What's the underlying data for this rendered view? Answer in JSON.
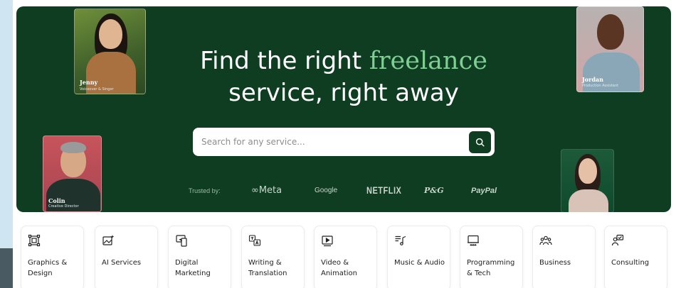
{
  "hero": {
    "headline_part1": "Find the right ",
    "headline_accent": "freelance",
    "headline_line2": "service, right away",
    "colors": {
      "background": "#0e3d22",
      "accent": "#7fcf92"
    }
  },
  "search": {
    "placeholder": "Search for any service...",
    "icon": "search-icon"
  },
  "trusted": {
    "label": "Trusted by:",
    "logos": [
      "Meta",
      "Google",
      "NETFLIX",
      "P&G",
      "PayPal"
    ]
  },
  "people": [
    {
      "name": "Jenny",
      "role": "Voiceover & Singer"
    },
    {
      "name": "Jordan",
      "role": "Production Assistant"
    },
    {
      "name": "Colin",
      "role": "Creative Director"
    }
  ],
  "categories": [
    {
      "label": "Graphics & Design",
      "icon": "graphics-design-icon"
    },
    {
      "label": "AI Services",
      "icon": "ai-services-icon"
    },
    {
      "label": "Digital Marketing",
      "icon": "digital-marketing-icon"
    },
    {
      "label": "Writing & Translation",
      "icon": "writing-translation-icon"
    },
    {
      "label": "Video & Animation",
      "icon": "video-animation-icon"
    },
    {
      "label": "Music & Audio",
      "icon": "music-audio-icon"
    },
    {
      "label": "Programming & Tech",
      "icon": "programming-tech-icon"
    },
    {
      "label": "Business",
      "icon": "business-icon"
    },
    {
      "label": "Consulting",
      "icon": "consulting-icon"
    }
  ]
}
